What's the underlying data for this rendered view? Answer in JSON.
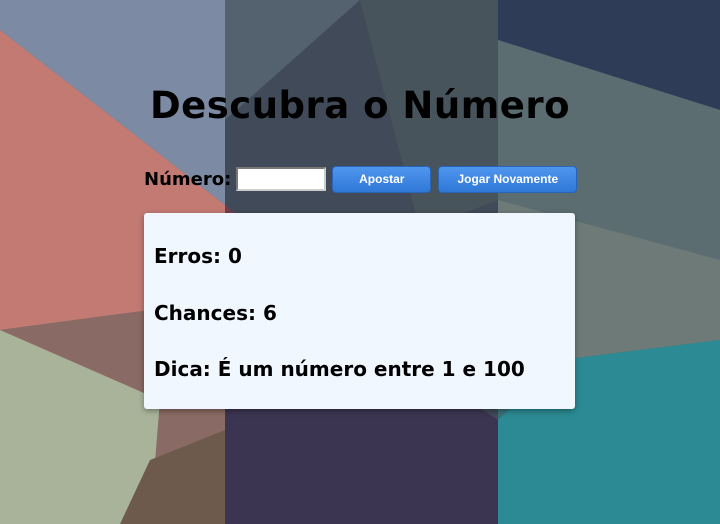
{
  "title": "Descubra o Número",
  "form": {
    "number_label": "Número:",
    "number_value": "",
    "bet_button": "Apostar",
    "play_again_button": "Jogar Novamente"
  },
  "status": {
    "errors_label": "Erros:",
    "errors_value": "0",
    "chances_label": "Chances:",
    "chances_value": "6",
    "hint_label": "Dica:",
    "hint_value": "É um número entre 1 e 100"
  },
  "colors": {
    "button": "#3a84e2",
    "panel": "#f0f7ff"
  }
}
